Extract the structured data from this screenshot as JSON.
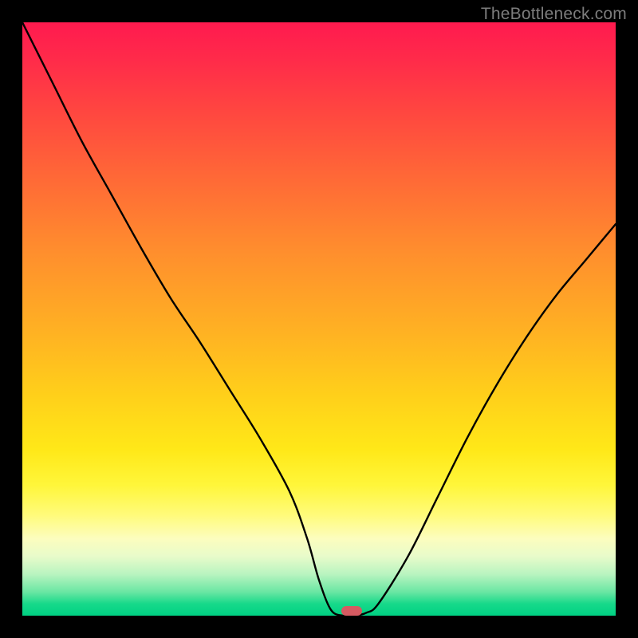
{
  "watermark": "TheBottleneck.com",
  "marker": {
    "x_pct": 55.5,
    "y_pct": 99.2,
    "color": "#d55a61"
  },
  "chart_data": {
    "type": "line",
    "title": "",
    "xlabel": "",
    "ylabel": "",
    "xlim": [
      0,
      100
    ],
    "ylim": [
      0,
      100
    ],
    "grid": false,
    "legend": false,
    "annotations": [
      "TheBottleneck.com"
    ],
    "series": [
      {
        "name": "bottleneck-curve",
        "x": [
          0,
          5,
          10,
          15,
          20,
          25,
          30,
          35,
          40,
          45,
          48,
          50,
          52,
          54,
          56,
          58,
          60,
          65,
          70,
          75,
          80,
          85,
          90,
          95,
          100
        ],
        "y": [
          100,
          90,
          80,
          71,
          62,
          53.5,
          46,
          38,
          30,
          21,
          13,
          6,
          1,
          0,
          0,
          0.5,
          2,
          10,
          20,
          30,
          39,
          47,
          54,
          60,
          66
        ]
      }
    ],
    "background_gradient": {
      "direction": "top-to-bottom",
      "stops": [
        {
          "pct": 0,
          "color": "#ff1a4f"
        },
        {
          "pct": 50,
          "color": "#ffb123"
        },
        {
          "pct": 78,
          "color": "#fff63a"
        },
        {
          "pct": 100,
          "color": "#00d183"
        }
      ]
    },
    "marker": {
      "x": 55.5,
      "y": 0
    }
  }
}
